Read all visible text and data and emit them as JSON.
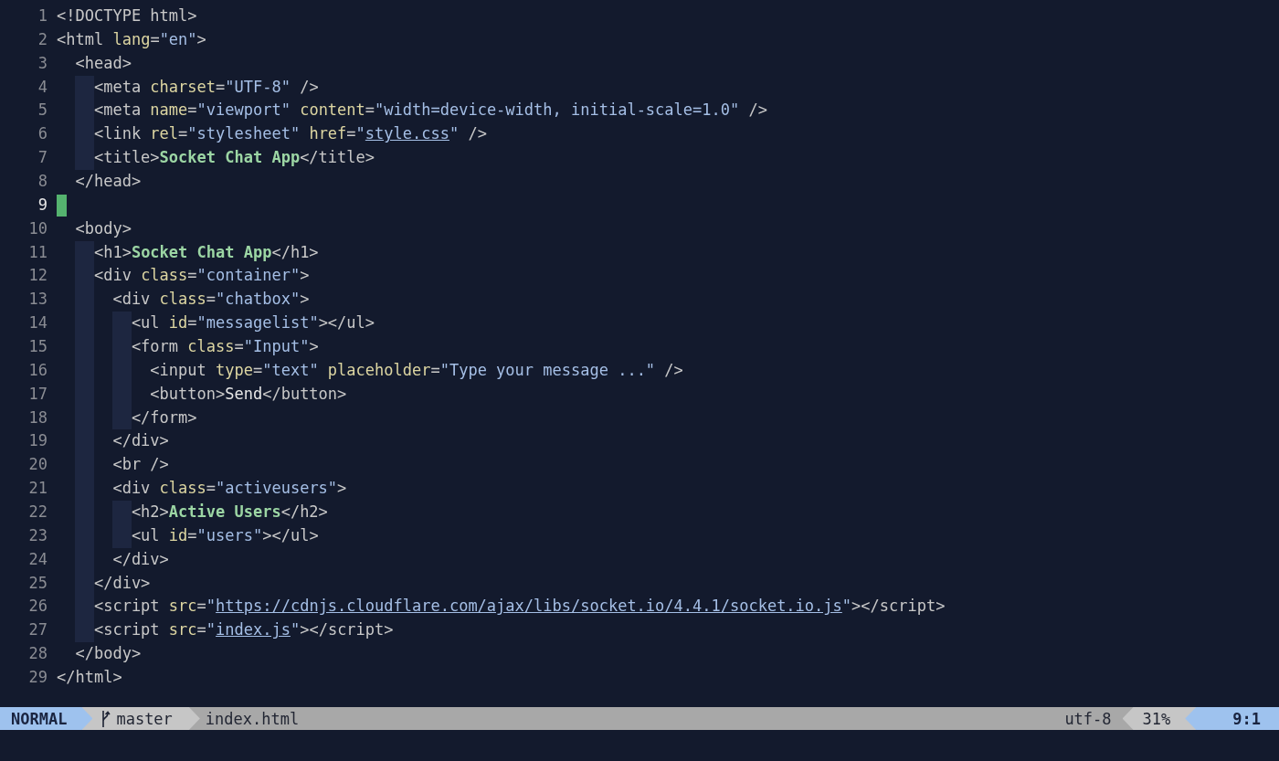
{
  "editor": {
    "lines": [
      {
        "number": "1",
        "cursor": false,
        "tokens": [
          {
            "kind": "punct",
            "text": "<!DOCTYPE html>"
          }
        ]
      },
      {
        "number": "2",
        "cursor": false,
        "tokens": [
          {
            "kind": "punct",
            "text": "<html "
          },
          {
            "kind": "attr",
            "text": "lang"
          },
          {
            "kind": "punct",
            "text": "="
          },
          {
            "kind": "string",
            "text": "\"en\""
          },
          {
            "kind": "punct",
            "text": ">"
          }
        ]
      },
      {
        "number": "3",
        "cursor": false,
        "tokens": [
          {
            "kind": "punct",
            "text": "  <head>"
          }
        ]
      },
      {
        "number": "4",
        "cursor": false,
        "tokens": [
          {
            "kind": "punct",
            "text": "    <meta "
          },
          {
            "kind": "attr",
            "text": "charset"
          },
          {
            "kind": "punct",
            "text": "="
          },
          {
            "kind": "string",
            "text": "\"UTF-8\""
          },
          {
            "kind": "punct",
            "text": " />"
          }
        ]
      },
      {
        "number": "5",
        "cursor": false,
        "tokens": [
          {
            "kind": "punct",
            "text": "    <meta "
          },
          {
            "kind": "attr",
            "text": "name"
          },
          {
            "kind": "punct",
            "text": "="
          },
          {
            "kind": "string",
            "text": "\"viewport\" "
          },
          {
            "kind": "attr",
            "text": "content"
          },
          {
            "kind": "punct",
            "text": "="
          },
          {
            "kind": "string",
            "text": "\"width=device-width, initial-scale=1.0\""
          },
          {
            "kind": "punct",
            "text": " />"
          }
        ]
      },
      {
        "number": "6",
        "cursor": false,
        "tokens": [
          {
            "kind": "punct",
            "text": "    <link "
          },
          {
            "kind": "attr",
            "text": "rel"
          },
          {
            "kind": "punct",
            "text": "="
          },
          {
            "kind": "string",
            "text": "\"stylesheet\" "
          },
          {
            "kind": "attr",
            "text": "href"
          },
          {
            "kind": "punct",
            "text": "="
          },
          {
            "kind": "string",
            "text": "\""
          },
          {
            "kind": "link",
            "text": "style.css"
          },
          {
            "kind": "string",
            "text": "\""
          },
          {
            "kind": "punct",
            "text": " />"
          }
        ]
      },
      {
        "number": "7",
        "cursor": false,
        "tokens": [
          {
            "kind": "punct",
            "text": "    <title>"
          },
          {
            "kind": "title",
            "text": "Socket Chat App"
          },
          {
            "kind": "punct",
            "text": "</title>"
          }
        ]
      },
      {
        "number": "8",
        "cursor": false,
        "tokens": [
          {
            "kind": "punct",
            "text": "  </head>"
          }
        ]
      },
      {
        "number": "9",
        "cursor": true
      },
      {
        "number": "10",
        "cursor": false,
        "tokens": [
          {
            "kind": "punct",
            "text": "  <body>"
          }
        ]
      },
      {
        "number": "11",
        "cursor": false,
        "tokens": [
          {
            "kind": "punct",
            "text": "    <h1>"
          },
          {
            "kind": "title",
            "text": "Socket Chat App"
          },
          {
            "kind": "punct",
            "text": "</h1>"
          }
        ]
      },
      {
        "number": "12",
        "cursor": false,
        "tokens": [
          {
            "kind": "punct",
            "text": "    <div "
          },
          {
            "kind": "attr",
            "text": "class"
          },
          {
            "kind": "punct",
            "text": "="
          },
          {
            "kind": "string",
            "text": "\"container\""
          },
          {
            "kind": "punct",
            "text": ">"
          }
        ]
      },
      {
        "number": "13",
        "cursor": false,
        "tokens": [
          {
            "kind": "punct",
            "text": "      <div "
          },
          {
            "kind": "attr",
            "text": "class"
          },
          {
            "kind": "punct",
            "text": "="
          },
          {
            "kind": "string",
            "text": "\"chatbox\""
          },
          {
            "kind": "punct",
            "text": ">"
          }
        ]
      },
      {
        "number": "14",
        "cursor": false,
        "tokens": [
          {
            "kind": "punct",
            "text": "        <ul "
          },
          {
            "kind": "attr",
            "text": "id"
          },
          {
            "kind": "punct",
            "text": "="
          },
          {
            "kind": "string",
            "text": "\"messagelist\""
          },
          {
            "kind": "punct",
            "text": "></ul>"
          }
        ]
      },
      {
        "number": "15",
        "cursor": false,
        "tokens": [
          {
            "kind": "punct",
            "text": "        <form "
          },
          {
            "kind": "attr",
            "text": "class"
          },
          {
            "kind": "punct",
            "text": "="
          },
          {
            "kind": "string",
            "text": "\"Input\""
          },
          {
            "kind": "punct",
            "text": ">"
          }
        ]
      },
      {
        "number": "16",
        "cursor": false,
        "tokens": [
          {
            "kind": "punct",
            "text": "          <input "
          },
          {
            "kind": "attr",
            "text": "type"
          },
          {
            "kind": "punct",
            "text": "="
          },
          {
            "kind": "string",
            "text": "\"text\" "
          },
          {
            "kind": "attr",
            "text": "placeholder"
          },
          {
            "kind": "punct",
            "text": "="
          },
          {
            "kind": "string",
            "text": "\"Type your message ...\""
          },
          {
            "kind": "punct",
            "text": " />"
          }
        ]
      },
      {
        "number": "17",
        "cursor": false,
        "tokens": [
          {
            "kind": "punct",
            "text": "          <button>"
          },
          {
            "kind": "text",
            "text": "Send"
          },
          {
            "kind": "punct",
            "text": "</button>"
          }
        ]
      },
      {
        "number": "18",
        "cursor": false,
        "tokens": [
          {
            "kind": "punct",
            "text": "        </form>"
          }
        ]
      },
      {
        "number": "19",
        "cursor": false,
        "tokens": [
          {
            "kind": "punct",
            "text": "      </div>"
          }
        ]
      },
      {
        "number": "20",
        "cursor": false,
        "tokens": [
          {
            "kind": "punct",
            "text": "      <br />"
          }
        ]
      },
      {
        "number": "21",
        "cursor": false,
        "tokens": [
          {
            "kind": "punct",
            "text": "      <div "
          },
          {
            "kind": "attr",
            "text": "class"
          },
          {
            "kind": "punct",
            "text": "="
          },
          {
            "kind": "string",
            "text": "\"activeusers\""
          },
          {
            "kind": "punct",
            "text": ">"
          }
        ]
      },
      {
        "number": "22",
        "cursor": false,
        "tokens": [
          {
            "kind": "punct",
            "text": "        <h2>"
          },
          {
            "kind": "title",
            "text": "Active Users"
          },
          {
            "kind": "punct",
            "text": "</h2>"
          }
        ]
      },
      {
        "number": "23",
        "cursor": false,
        "tokens": [
          {
            "kind": "punct",
            "text": "        <ul "
          },
          {
            "kind": "attr",
            "text": "id"
          },
          {
            "kind": "punct",
            "text": "="
          },
          {
            "kind": "string",
            "text": "\"users\""
          },
          {
            "kind": "punct",
            "text": "></ul>"
          }
        ]
      },
      {
        "number": "24",
        "cursor": false,
        "tokens": [
          {
            "kind": "punct",
            "text": "      </div>"
          }
        ]
      },
      {
        "number": "25",
        "cursor": false,
        "tokens": [
          {
            "kind": "punct",
            "text": "    </div>"
          }
        ]
      },
      {
        "number": "26",
        "cursor": false,
        "tokens": [
          {
            "kind": "punct",
            "text": "    <script "
          },
          {
            "kind": "attr",
            "text": "src"
          },
          {
            "kind": "punct",
            "text": "="
          },
          {
            "kind": "string",
            "text": "\""
          },
          {
            "kind": "link",
            "text": "https://cdnjs.cloudflare.com/ajax/libs/socket.io/4.4.1/socket.io.js"
          },
          {
            "kind": "string",
            "text": "\""
          },
          {
            "kind": "punct",
            "text": "></script>"
          }
        ]
      },
      {
        "number": "27",
        "cursor": false,
        "tokens": [
          {
            "kind": "punct",
            "text": "    <script "
          },
          {
            "kind": "attr",
            "text": "src"
          },
          {
            "kind": "punct",
            "text": "="
          },
          {
            "kind": "string",
            "text": "\""
          },
          {
            "kind": "link",
            "text": "index.js"
          },
          {
            "kind": "string",
            "text": "\""
          },
          {
            "kind": "punct",
            "text": "></script>"
          }
        ]
      },
      {
        "number": "28",
        "cursor": false,
        "tokens": [
          {
            "kind": "punct",
            "text": "  </body>"
          }
        ]
      },
      {
        "number": "29",
        "cursor": false,
        "tokens": [
          {
            "kind": "punct",
            "text": "</html>"
          }
        ]
      }
    ]
  },
  "status_bar": {
    "mode": "NORMAL",
    "branch": "master",
    "file": "index.html",
    "encoding": "utf-8",
    "percent": "31%",
    "position": "9:1"
  }
}
